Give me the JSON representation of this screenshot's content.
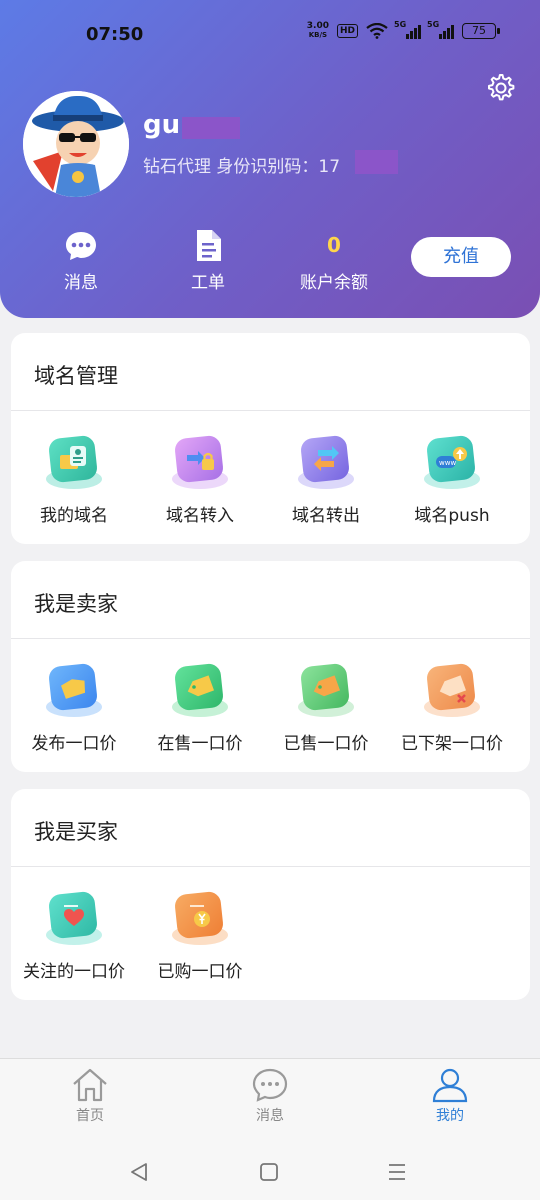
{
  "status_bar": {
    "time": "07:50",
    "net_speed_value": "3.00",
    "net_speed_unit": "KB/S",
    "hd_badge": "HD",
    "signal_label_1": "5G",
    "signal_label_2": "5G",
    "battery": "75"
  },
  "profile": {
    "username": "gu",
    "identity_label": "钻石代理 身份识别码：17",
    "settings_icon": "gear-icon",
    "avatar": "cartoon-avatar"
  },
  "quick_actions": [
    {
      "label": "消息",
      "icon": "chat-bubble-icon"
    },
    {
      "label": "工单",
      "icon": "document-icon"
    }
  ],
  "balance": {
    "value": "0",
    "label": "账户余额"
  },
  "recharge_label": "充值",
  "sections": {
    "domain": {
      "title": "域名管理",
      "items": [
        {
          "label": "我的域名",
          "icon": "folder-id-icon"
        },
        {
          "label": "域名转入",
          "icon": "transfer-in-lock-icon"
        },
        {
          "label": "域名转出",
          "icon": "transfer-out-icon"
        },
        {
          "label": "域名push",
          "icon": "www-push-icon"
        }
      ]
    },
    "seller": {
      "title": "我是卖家",
      "items": [
        {
          "label": "发布一口价",
          "icon": "publish-tag-icon"
        },
        {
          "label": "在售一口价",
          "icon": "sale-tag-icon"
        },
        {
          "label": "已售一口价",
          "icon": "sold-tag-icon"
        },
        {
          "label": "已下架一口价",
          "icon": "off-tag-icon"
        }
      ]
    },
    "buyer": {
      "title": "我是买家",
      "items": [
        {
          "label": "关注的一口价",
          "icon": "heart-card-icon"
        },
        {
          "label": "已购一口价",
          "icon": "yen-coin-icon"
        }
      ]
    }
  },
  "tabbar": {
    "items": [
      {
        "label": "首页",
        "icon": "home-icon"
      },
      {
        "label": "消息",
        "icon": "chat-icon"
      },
      {
        "label": "我的",
        "icon": "person-icon"
      }
    ],
    "active_color": "#2f7fd6"
  },
  "colors": {
    "header_start": "#5d7be6",
    "header_end": "#7a4fb3",
    "balance": "#ffd54a",
    "recharge_text": "#2f73d6"
  }
}
